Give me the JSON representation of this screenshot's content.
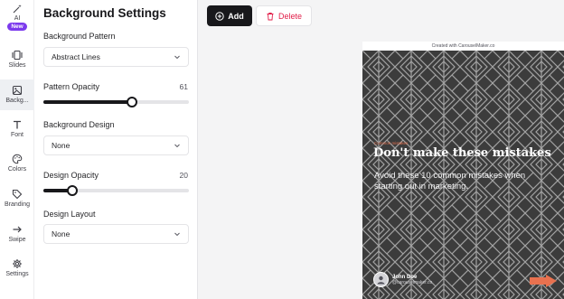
{
  "rail": {
    "ai_label": "AI",
    "new_badge": "New",
    "items": [
      {
        "label": "Slides"
      },
      {
        "label": "Backg..."
      },
      {
        "label": "Font"
      },
      {
        "label": "Colors"
      },
      {
        "label": "Branding"
      },
      {
        "label": "Swipe"
      },
      {
        "label": "Settings"
      }
    ]
  },
  "panel": {
    "title": "Background Settings",
    "background_pattern": {
      "label": "Background Pattern",
      "value": "Abstract Lines"
    },
    "pattern_opacity": {
      "label": "Pattern Opacity",
      "value": "61",
      "fraction": 0.61
    },
    "background_design": {
      "label": "Background Design",
      "value": "None"
    },
    "design_opacity": {
      "label": "Design Opacity",
      "value": "20",
      "fraction": 0.2
    },
    "design_layout": {
      "label": "Design Layout",
      "value": "None"
    }
  },
  "toolbar": {
    "add_label": "Add",
    "delete_label": "Delete"
  },
  "slide": {
    "watermark": "Created with CarouselMaker.co",
    "eyebrow": "Common mistakes",
    "headline": "Don't make these mistakes",
    "subtext": "Avoid these 10 common mistakes when starting out in marketing.",
    "author_name": "John Doe",
    "author_handle": "@carouselmaker.co",
    "accent_color": "#e8714f",
    "background_color": "#3c3c3c"
  }
}
